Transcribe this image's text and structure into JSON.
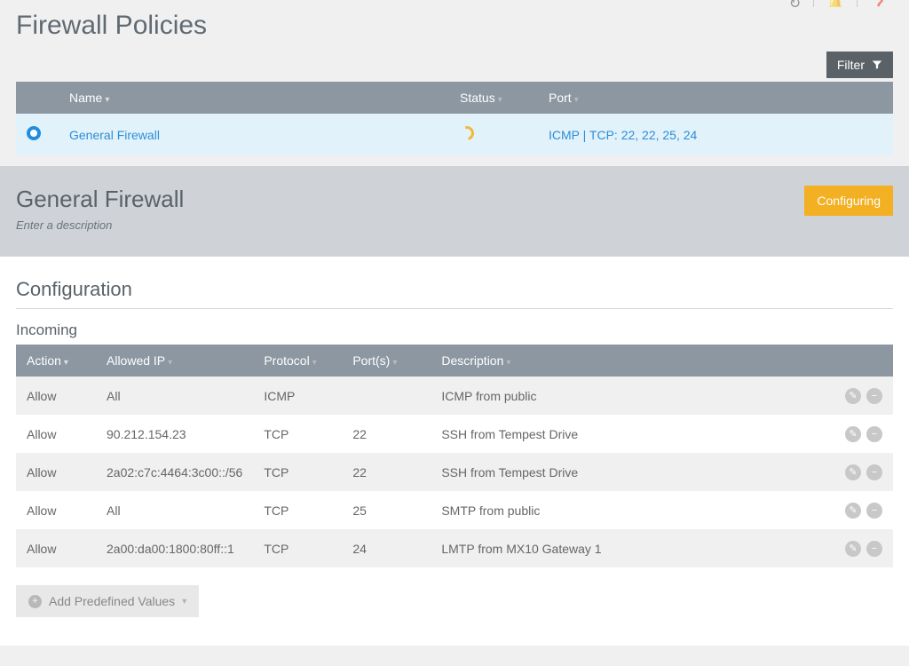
{
  "header_icons": [
    "refresh-icon",
    "separator",
    "bell-icon",
    "separator",
    "help-icon"
  ],
  "page_title": "Firewall Policies",
  "filter_label": "Filter",
  "list": {
    "columns": {
      "name": "Name",
      "status": "Status",
      "port": "Port"
    },
    "row": {
      "name": "General Firewall",
      "port": "ICMP | TCP: 22, 22, 25, 24"
    }
  },
  "detail": {
    "title": "General Firewall",
    "description_placeholder": "Enter a description",
    "status": "Configuring"
  },
  "config": {
    "heading": "Configuration",
    "incoming_label": "Incoming",
    "columns": {
      "action": "Action",
      "allowed_ip": "Allowed IP",
      "protocol": "Protocol",
      "ports": "Port(s)",
      "description": "Description"
    },
    "rules": [
      {
        "action": "Allow",
        "ip": "All",
        "protocol": "ICMP",
        "ports": "",
        "description": "ICMP from public"
      },
      {
        "action": "Allow",
        "ip": "90.212.154.23",
        "protocol": "TCP",
        "ports": "22",
        "description": "SSH from Tempest Drive"
      },
      {
        "action": "Allow",
        "ip": "2a02:c7c:4464:3c00::/56",
        "protocol": "TCP",
        "ports": "22",
        "description": "SSH from Tempest Drive"
      },
      {
        "action": "Allow",
        "ip": "All",
        "protocol": "TCP",
        "ports": "25",
        "description": "SMTP from public"
      },
      {
        "action": "Allow",
        "ip": "2a00:da00:1800:80ff::1",
        "protocol": "TCP",
        "ports": "24",
        "description": "LMTP from MX10 Gateway 1"
      }
    ],
    "add_button": "Add Predefined Values"
  }
}
